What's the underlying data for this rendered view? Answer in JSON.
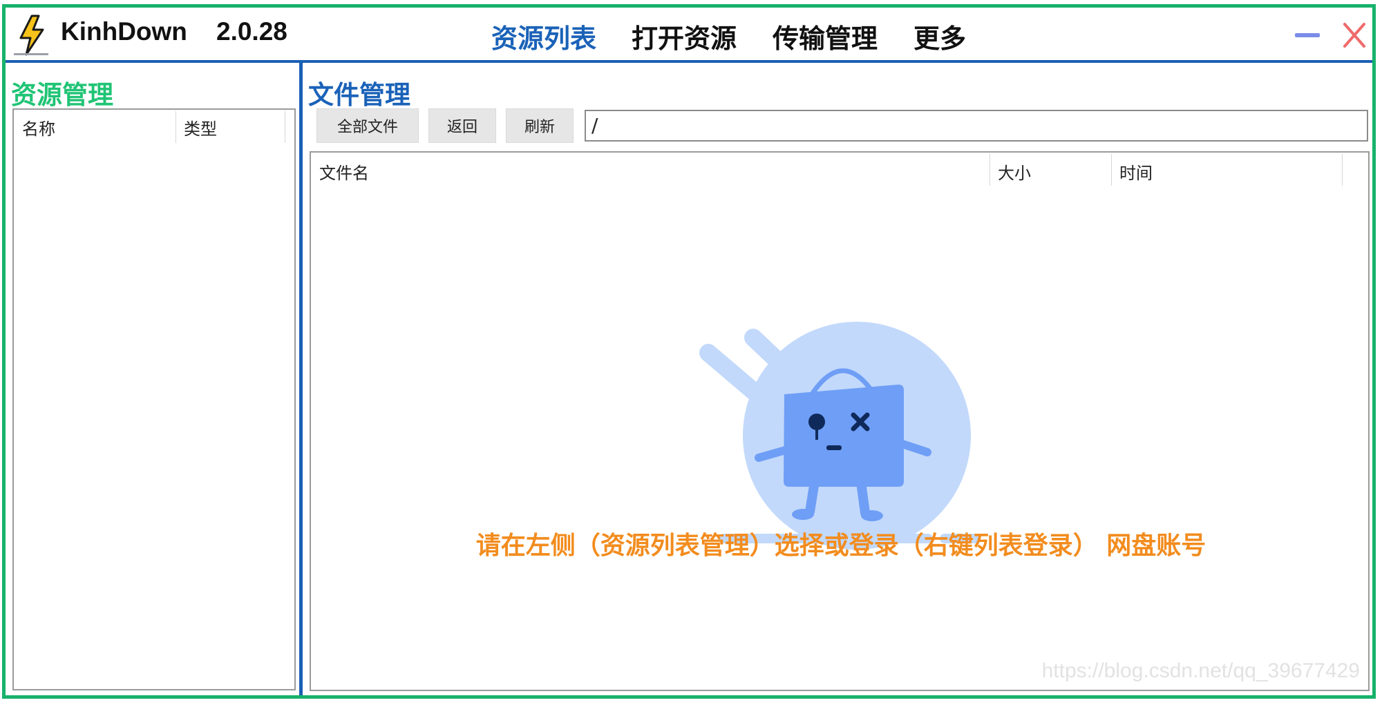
{
  "app": {
    "name": "KinhDown",
    "version": "2.0.28",
    "accent_color": "#1a62b8",
    "frame_color": "#17b26b"
  },
  "menu": {
    "items": [
      {
        "label": "资源列表",
        "active": true
      },
      {
        "label": "打开资源",
        "active": false
      },
      {
        "label": "传输管理",
        "active": false
      },
      {
        "label": "更多",
        "active": false
      }
    ]
  },
  "window_controls": {
    "minimize_icon": "minimize-icon",
    "close_icon": "close-icon",
    "minimize_color": "#7b8de8",
    "close_color": "#f06a6a"
  },
  "left_panel": {
    "title": "资源管理",
    "title_color": "#20c475",
    "columns": [
      "名称",
      "类型"
    ]
  },
  "right_panel": {
    "title": "文件管理",
    "buttons": {
      "all_files": "全部文件",
      "back": "返回",
      "refresh": "刷新"
    },
    "path_value": "/",
    "columns": [
      "文件名",
      "大小",
      "时间"
    ],
    "empty_message": "请在左侧（资源列表管理）选择或登录（右键列表登录） 网盘账号",
    "empty_message_color": "#f28c1e",
    "empty_icon": "empty-box-mascot-icon"
  },
  "watermark": "https://blog.csdn.net/qq_39677429"
}
